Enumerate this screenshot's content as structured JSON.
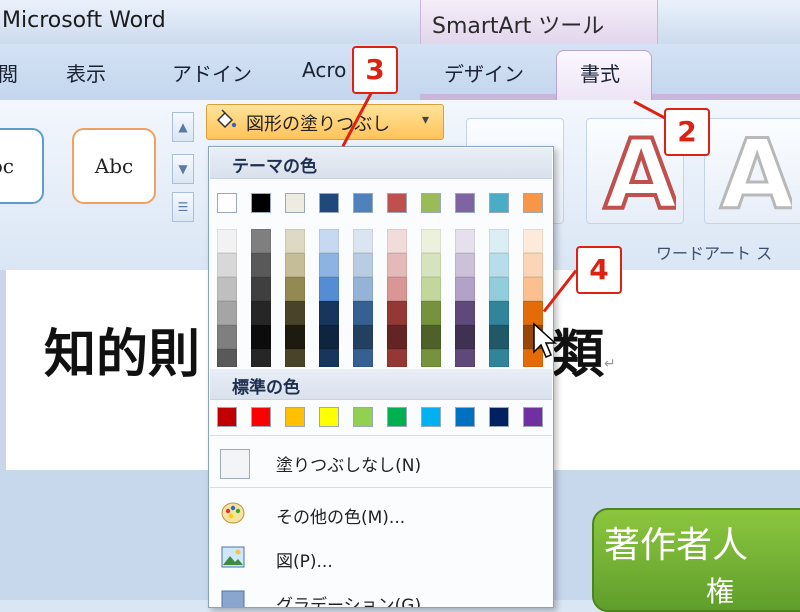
{
  "title_bar": {
    "app_title": "Microsoft Word",
    "context_label": "SmartArt ツール"
  },
  "tabs": [
    {
      "label": "閲",
      "id": "review"
    },
    {
      "label": "表示",
      "id": "view"
    },
    {
      "label": "アドイン",
      "id": "addins"
    },
    {
      "label": "Acro",
      "id": "acrobat"
    },
    {
      "label": "デザイン",
      "id": "design"
    },
    {
      "label": "書式",
      "id": "format",
      "active": true
    }
  ],
  "ribbon": {
    "shape_styles": [
      {
        "label": "bc"
      },
      {
        "label": "Abc"
      }
    ],
    "fill_button": {
      "label": "図形の塗りつぶし",
      "icon": "paint-bucket-icon"
    },
    "wordart_group_label": "ワードアート ス"
  },
  "dropdown": {
    "theme_colors_title": "テーマの色",
    "theme_colors": [
      "#ffffff",
      "#000000",
      "#eeece1",
      "#1f497d",
      "#4f81bd",
      "#c0504d",
      "#9bbb59",
      "#8064a2",
      "#4bacc6",
      "#f79646"
    ],
    "theme_shades": [
      [
        "#f2f2f2",
        "#d8d8d8",
        "#bfbfbf",
        "#a5a5a5",
        "#7f7f7f",
        "#595959"
      ],
      [
        "#7f7f7f",
        "#595959",
        "#3f3f3f",
        "#262626",
        "#0c0c0c",
        "#262626"
      ],
      [
        "#ddd9c3",
        "#c4bd97",
        "#938953",
        "#494429",
        "#1d1b10",
        "#494429"
      ],
      [
        "#c6d9f0",
        "#8db3e2",
        "#548dd4",
        "#17365d",
        "#0f243e",
        "#17365d"
      ],
      [
        "#dbe5f1",
        "#b8cce4",
        "#95b3d7",
        "#366092",
        "#244061",
        "#366092"
      ],
      [
        "#f2dcdb",
        "#e5b9b7",
        "#d99694",
        "#953734",
        "#632423",
        "#953734"
      ],
      [
        "#ebf1dd",
        "#d7e3bc",
        "#c3d69b",
        "#76923c",
        "#4f6128",
        "#76923c"
      ],
      [
        "#e5e0ec",
        "#ccc1d9",
        "#b2a2c7",
        "#5f497a",
        "#3f3151",
        "#5f497a"
      ],
      [
        "#dbeef3",
        "#b7dde8",
        "#92cddc",
        "#31859b",
        "#205867",
        "#31859b"
      ],
      [
        "#fdeada",
        "#fbd5b5",
        "#fac08f",
        "#e36c09",
        "#974806",
        "#e36c09"
      ]
    ],
    "standard_colors_title": "標準の色",
    "standard_colors": [
      "#c00000",
      "#ff0000",
      "#ffc000",
      "#ffff00",
      "#92d050",
      "#00b050",
      "#00b0f0",
      "#0070c0",
      "#002060",
      "#7030a0"
    ],
    "menu_items": [
      {
        "label": "塗りつぶしなし(N)",
        "icon": "no-fill-swatch"
      },
      {
        "label": "その他の色(M)...",
        "icon": "color-palette-icon"
      },
      {
        "label": "図(P)...",
        "icon": "picture-icon"
      },
      {
        "label": "グラデーション(G)",
        "icon": "gradient-icon"
      }
    ]
  },
  "document": {
    "heading_left": "知的則",
    "heading_right": "類",
    "return_mark": "↵",
    "author_box_line1": "著作者人",
    "author_box_line2": "権"
  },
  "callouts": [
    "2",
    "3",
    "4"
  ]
}
